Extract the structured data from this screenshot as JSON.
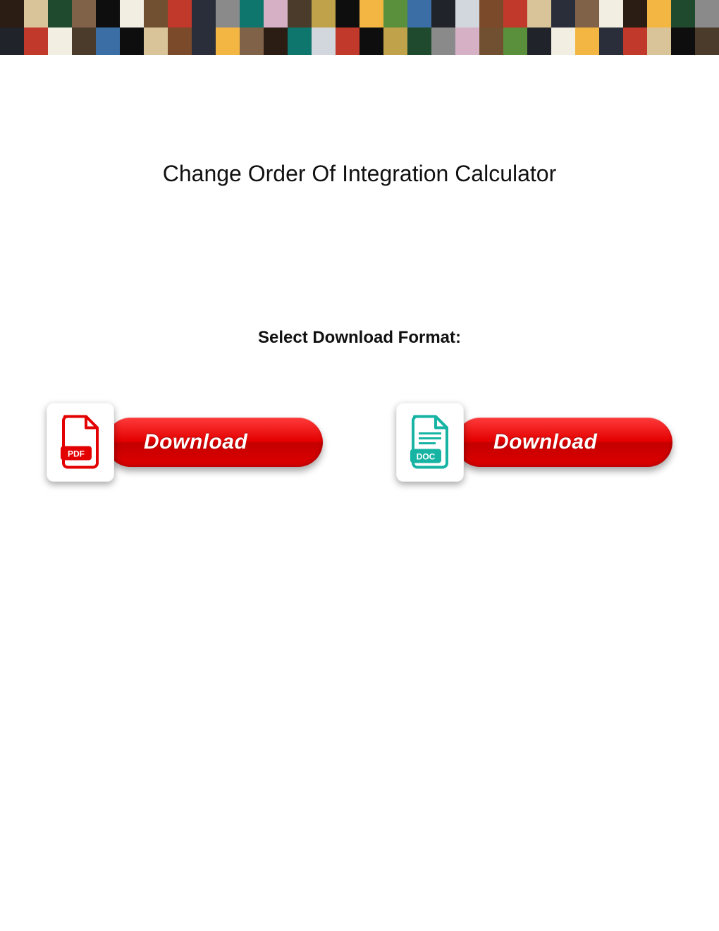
{
  "title": "Change Order Of Integration Calculator",
  "select_label": "Select Download Format:",
  "downloads": {
    "pdf": {
      "format": "PDF",
      "button_label": "Download"
    },
    "doc": {
      "format": "DOC",
      "button_label": "Download"
    }
  }
}
